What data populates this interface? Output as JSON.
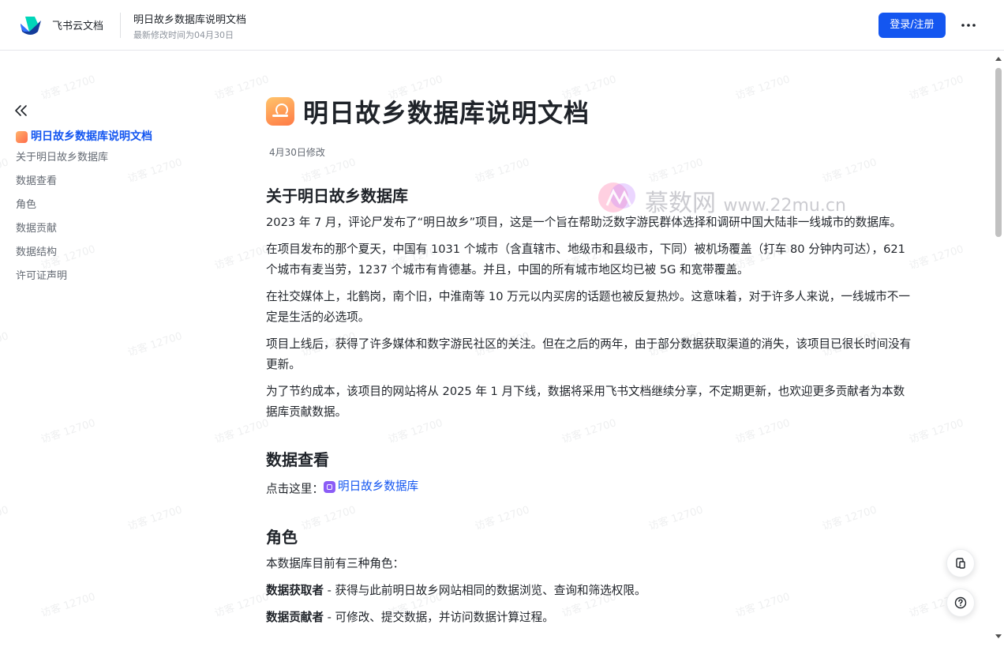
{
  "header": {
    "brand": "飞书云文档",
    "doc_title": "明日故乡数据库说明文档",
    "doc_meta": "最新修改时间为04月30日",
    "login_label": "登录/注册"
  },
  "toc": {
    "items": [
      {
        "label": "明日故乡数据库说明文档",
        "active": true
      },
      {
        "label": "关于明日故乡数据库"
      },
      {
        "label": "数据查看"
      },
      {
        "label": "角色"
      },
      {
        "label": "数据贡献"
      },
      {
        "label": "数据结构"
      },
      {
        "label": "许可证声明"
      }
    ]
  },
  "doc": {
    "title": "明日故乡数据库说明文档",
    "modified": "4月30日修改",
    "s1": {
      "heading": "关于明日故乡数据库",
      "p1": "2023 年 7 月，评论尸发布了“明日故乡”项目，这是一个旨在帮助泛数字游民群体选择和调研中国大陆非一线城市的数据库。",
      "p2": "在项目发布的那个夏天，中国有 1031 个城市（含直辖市、地级市和县级市，下同）被机场覆盖（打车 80 分钟内可达），621 个城市有麦当劳，1237 个城市有肯德基。并且，中国的所有城市地区均已被 5G 和宽带覆盖。",
      "p3": "在社交媒体上，北鹤岗，南个旧，中淮南等 10 万元以内买房的话题也被反复热炒。这意味着，对于许多人来说，一线城市不一定是生活的必选项。",
      "p4": "项目上线后，获得了许多媒体和数字游民社区的关注。但在之后的两年，由于部分数据获取渠道的消失，该项目已很长时间没有更新。",
      "p5": "为了节约成本，该项目的网站将从 2025 年 1 月下线，数据将采用飞书文档继续分享，不定期更新，也欢迎更多贡献者为本数据库贡献数据。"
    },
    "s2": {
      "heading": "数据查看",
      "prefix": "点击这里：",
      "link": "明日故乡数据库"
    },
    "s3": {
      "heading": "角色",
      "intro": "本数据库目前有三种角色：",
      "role1_name": "数据获取者",
      "role1_desc": " - 获得与此前明日故乡网站相同的数据浏览、查询和筛选权限。",
      "role2_name": "数据贡献者",
      "role2_desc": " - 可修改、提交数据，并访问数据计算过程。"
    }
  },
  "watermark": {
    "text": "访客 12700",
    "brand_name": "慕数网",
    "brand_url": "www.22mu.cn"
  }
}
